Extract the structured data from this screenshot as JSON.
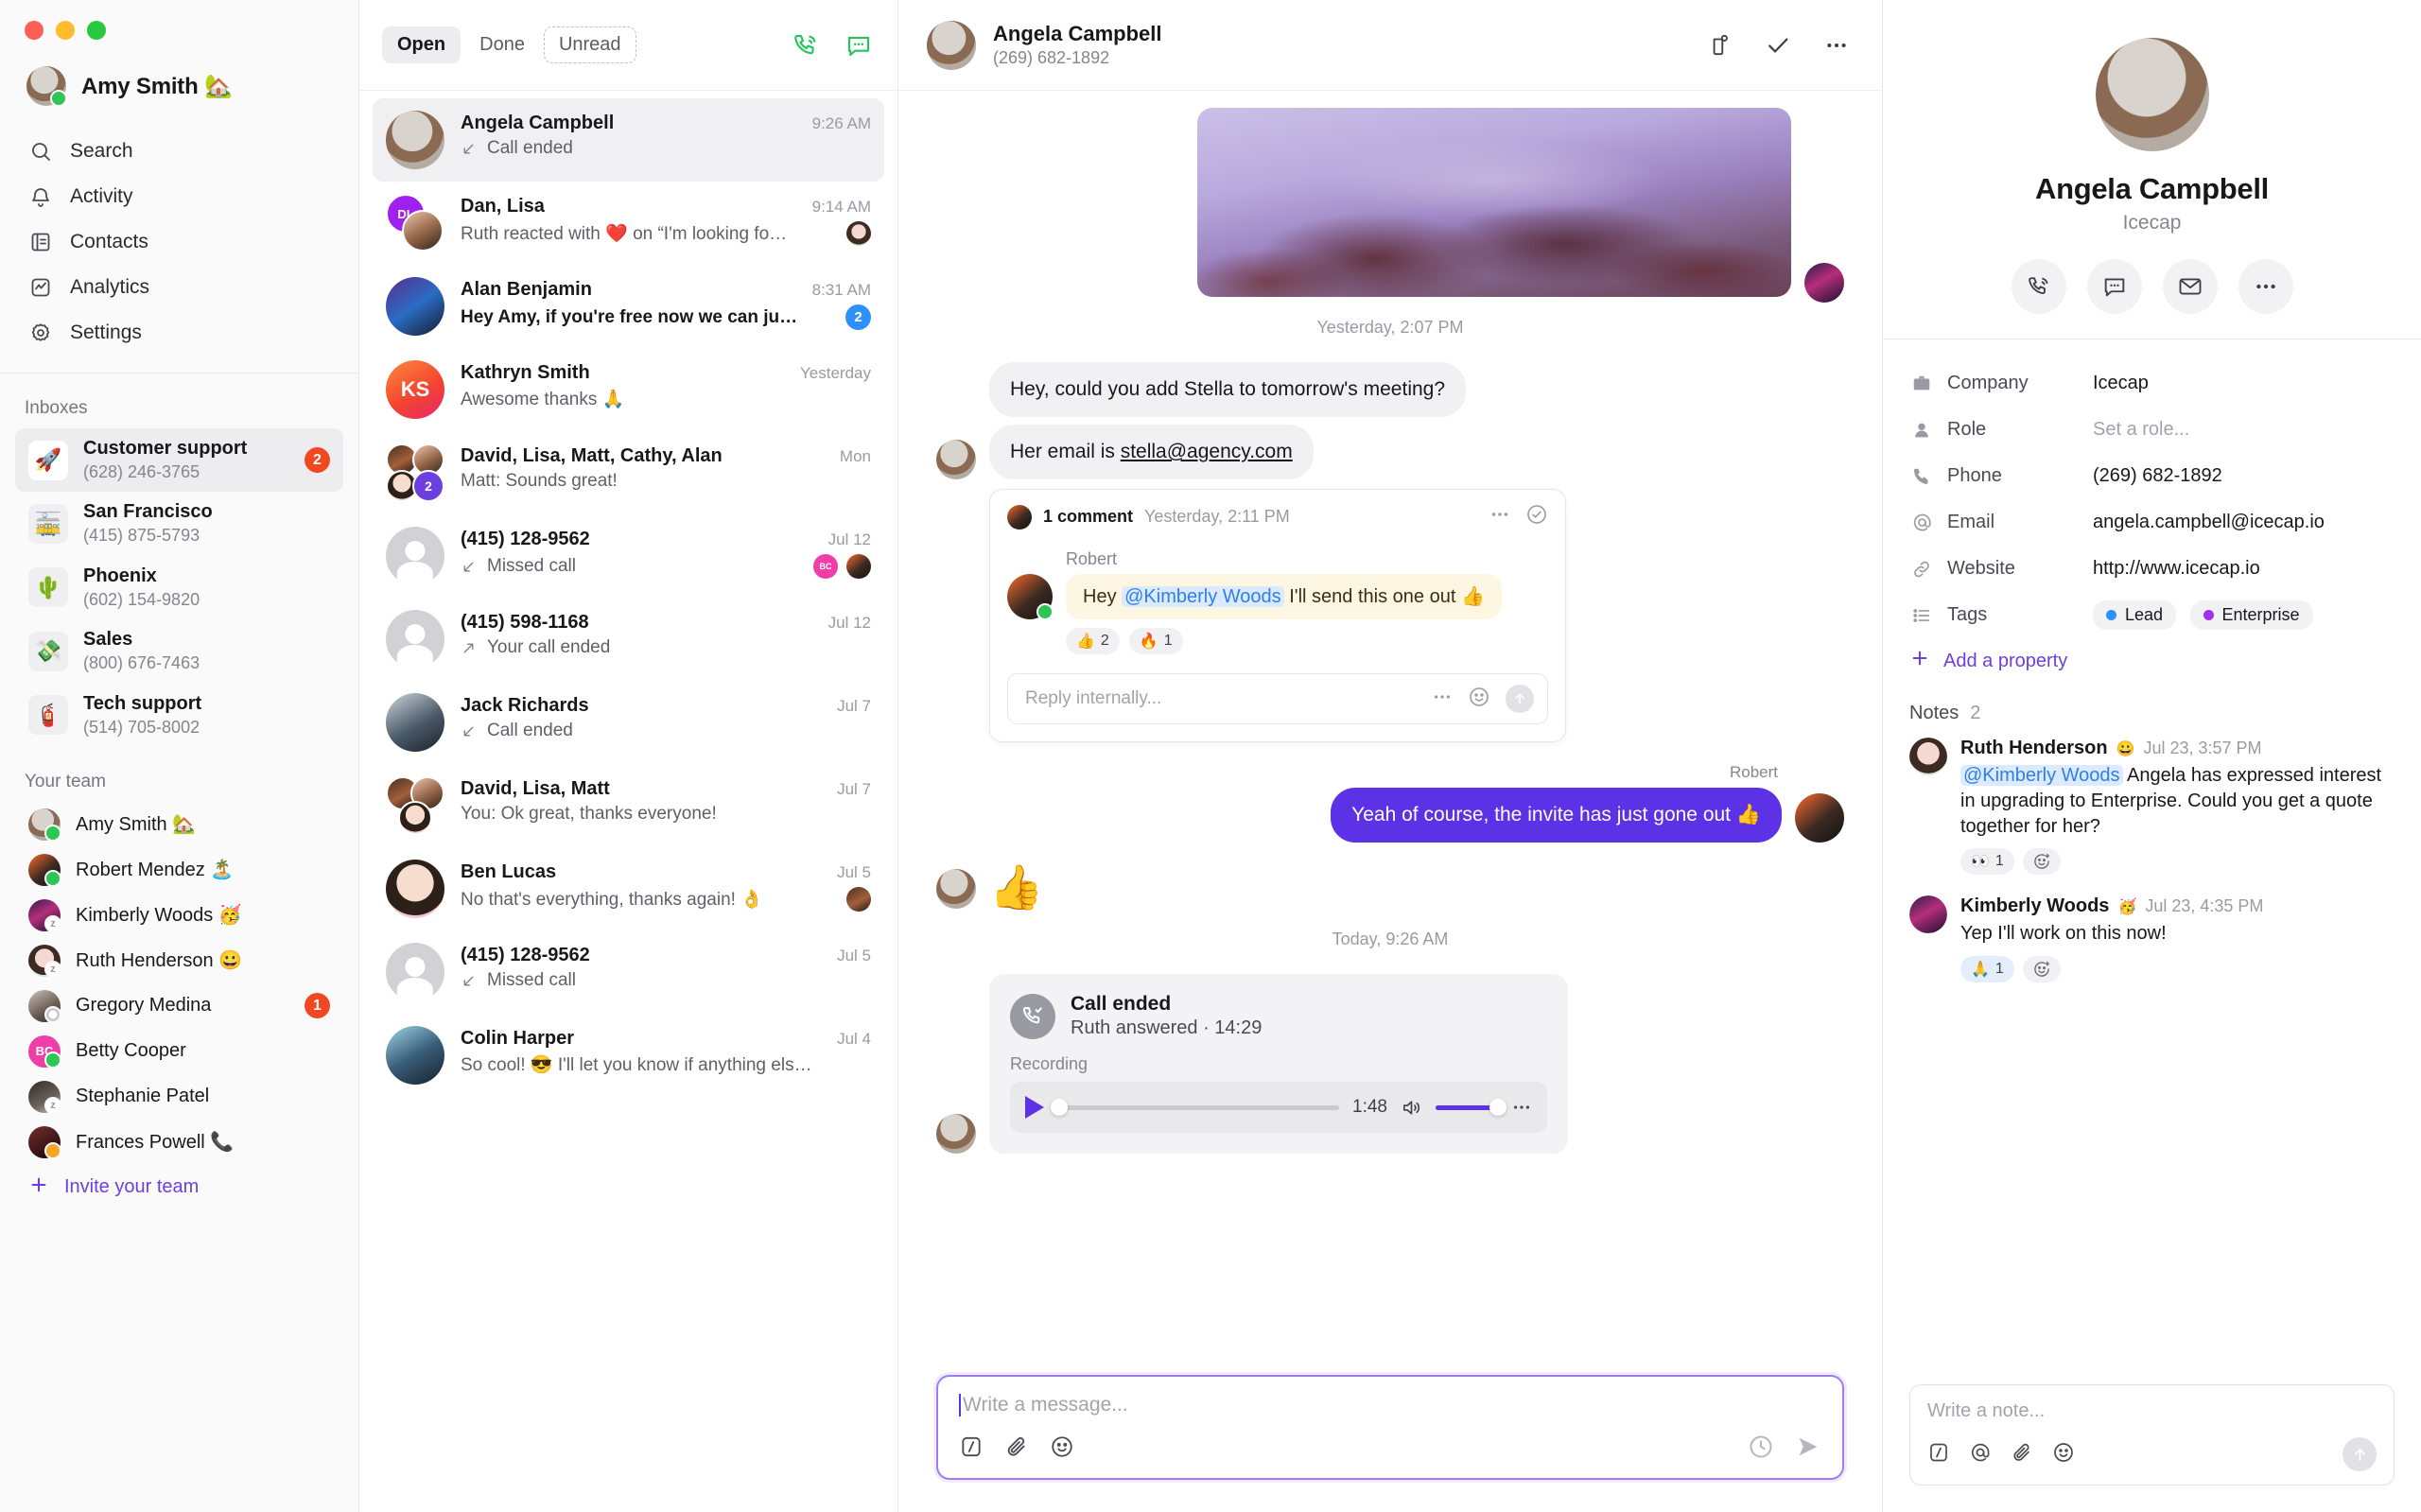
{
  "sidebar": {
    "user": {
      "name": "Amy Smith",
      "emoji": "🏡",
      "status": "online"
    },
    "nav": [
      {
        "label": "Search",
        "icon": "search-icon"
      },
      {
        "label": "Activity",
        "icon": "bell-icon"
      },
      {
        "label": "Contacts",
        "icon": "contacts-book-icon"
      },
      {
        "label": "Analytics",
        "icon": "analytics-icon"
      },
      {
        "label": "Settings",
        "icon": "gear-icon"
      }
    ],
    "inboxes_title": "Inboxes",
    "inboxes": [
      {
        "name": "Customer support",
        "phone": "(628) 246-3765",
        "emoji": "🚀",
        "badge": "2",
        "active": true
      },
      {
        "name": "San Francisco",
        "phone": "(415) 875-5793",
        "emoji": "🚋",
        "badge": "",
        "active": false
      },
      {
        "name": "Phoenix",
        "phone": "(602) 154-9820",
        "emoji": "🌵",
        "badge": "",
        "active": false
      },
      {
        "name": "Sales",
        "phone": "(800) 676-7463",
        "emoji": "💸",
        "badge": "",
        "active": false
      },
      {
        "name": "Tech support",
        "phone": "(514) 705-8002",
        "emoji": "🧯",
        "badge": "",
        "active": false
      }
    ],
    "team_title": "Your team",
    "team": [
      {
        "name": "Amy Smith",
        "emoji": "🏡",
        "status": "online",
        "badge": "",
        "av": "ph1"
      },
      {
        "name": "Robert Mendez",
        "emoji": "🏝️",
        "status": "online",
        "badge": "",
        "av": "ph2"
      },
      {
        "name": "Kimberly Woods",
        "emoji": "🥳",
        "status": "snooze",
        "badge": "",
        "av": "ph3"
      },
      {
        "name": "Ruth Henderson",
        "emoji": "😀",
        "status": "snooze",
        "badge": "",
        "av": "ph4"
      },
      {
        "name": "Gregory Medina",
        "emoji": "",
        "status": "offline",
        "badge": "1",
        "av": "ph5"
      },
      {
        "name": "Betty Cooper",
        "emoji": "",
        "status": "online",
        "badge": "",
        "av": "bc-grad",
        "initials": "BC"
      },
      {
        "name": "Stephanie Patel",
        "emoji": "",
        "status": "snooze",
        "badge": "",
        "av": "ph6"
      },
      {
        "name": "Frances Powell",
        "emoji": "📞",
        "status": "away",
        "badge": "",
        "av": "ph8"
      }
    ],
    "invite_label": "Invite your team"
  },
  "conversation_list": {
    "filters": [
      {
        "label": "Open",
        "active": true,
        "style": "active"
      },
      {
        "label": "Done",
        "active": false,
        "style": "plain"
      },
      {
        "label": "Unread",
        "active": false,
        "style": "dashed"
      }
    ],
    "header_icons": [
      "phone-call-icon",
      "new-message-icon"
    ],
    "items": [
      {
        "name": "Angela Campbell",
        "time": "9:26 AM",
        "preview": "Call ended",
        "dir": "in",
        "active": true,
        "av": "ph1",
        "badge": "",
        "bold": false
      },
      {
        "name": "Dan, Lisa",
        "time": "9:14 AM",
        "preview": "Ruth reacted with ❤️ on “I'm looking fo…",
        "dir": "",
        "active": false,
        "av": "stack-dl",
        "badge": "",
        "bold": false,
        "mini": "ph4"
      },
      {
        "name": "Alan Benjamin",
        "time": "8:31 AM",
        "preview": "Hey Amy, if you're free now we can ju…",
        "dir": "",
        "active": false,
        "av": "ph9",
        "badge": "2",
        "bold": true
      },
      {
        "name": "Kathryn Smith",
        "time": "Yesterday",
        "preview": "Awesome thanks 🙏",
        "dir": "",
        "active": false,
        "av": "ks-grad",
        "initials": "KS",
        "badge": "",
        "bold": false
      },
      {
        "name": "David, Lisa, Matt, Cathy, Alan",
        "time": "Mon",
        "preview": "Matt: Sounds great!",
        "dir": "",
        "active": false,
        "av": "stack-4",
        "badge": "2",
        "bold": false
      },
      {
        "name": "(415) 128-9562",
        "time": "Jul 12",
        "preview": "Missed call",
        "dir": "in",
        "active": false,
        "av": "ph-grey",
        "badge": "",
        "bold": false,
        "mini2": true
      },
      {
        "name": "(415) 598-1168",
        "time": "Jul 12",
        "preview": "Your call ended",
        "dir": "out",
        "active": false,
        "av": "ph-grey",
        "badge": "",
        "bold": false
      },
      {
        "name": "Jack Richards",
        "time": "Jul 7",
        "preview": "Call ended",
        "dir": "in",
        "active": false,
        "av": "ph11",
        "badge": "",
        "bold": false
      },
      {
        "name": "David, Lisa, Matt",
        "time": "Jul 7",
        "preview": "You: Ok great, thanks everyone!",
        "dir": "",
        "active": false,
        "av": "stack-3",
        "badge": "",
        "bold": false
      },
      {
        "name": "Ben Lucas",
        "time": "Jul 5",
        "preview": "No that's everything, thanks again! 👌",
        "dir": "",
        "active": false,
        "av": "ph12",
        "badge": "",
        "bold": false,
        "mini": "ph7"
      },
      {
        "name": "(415) 128-9562",
        "time": "Jul 5",
        "preview": "Missed call",
        "dir": "in",
        "active": false,
        "av": "ph-grey",
        "badge": "",
        "bold": false
      },
      {
        "name": "Colin Harper",
        "time": "Jul 4",
        "preview": "So cool! 😎 I'll let you know if anything els…",
        "dir": "",
        "active": false,
        "av": "ph13",
        "badge": "",
        "bold": false
      }
    ]
  },
  "thread": {
    "title": "Angela Campbell",
    "subtitle": "(269) 682-1892",
    "actions": [
      "snooze-icon",
      "mark-done-icon",
      "more-options-icon"
    ],
    "day_sep_1": "Yesterday, 2:07 PM",
    "messages": [
      {
        "type": "image",
        "side": "in"
      },
      {
        "type": "text",
        "side": "in",
        "text": "Hey, could you add Stella to tomorrow's meeting?"
      },
      {
        "type": "text",
        "side": "in",
        "text": "Her email is ",
        "link": "stella@agency.com"
      }
    ],
    "comment": {
      "count_label": "1 comment",
      "time": "Yesterday, 2:11 PM",
      "author": "Robert",
      "text_before": "Hey ",
      "mention": "@Kimberly Woods",
      "text_after": " I'll send this one out 👍",
      "reactions": [
        {
          "emoji": "👍",
          "count": "2"
        },
        {
          "emoji": "🔥",
          "count": "1"
        }
      ],
      "reply_placeholder": "Reply internally..."
    },
    "outgoing": {
      "sender": "Robert",
      "text": "Yeah of course, the invite has just gone out 👍"
    },
    "reaction_msg": "👍",
    "day_sep_2": "Today, 9:26 AM",
    "call_card": {
      "title": "Call ended",
      "subtitle": "Ruth answered · 14:29",
      "recording_label": "Recording",
      "duration": "1:48"
    },
    "composer": {
      "placeholder": "Write a message...",
      "icons": [
        "snippet-icon",
        "attachment-icon",
        "emoji-icon",
        "schedule-send-icon",
        "send-icon"
      ]
    }
  },
  "right_panel": {
    "name": "Angela Campbell",
    "company": "Icecap",
    "actions": [
      "call-icon",
      "message-icon",
      "email-icon",
      "more-options-icon"
    ],
    "properties": [
      {
        "icon": "briefcase-icon",
        "label": "Company",
        "value": "Icecap",
        "muted": false
      },
      {
        "icon": "person-icon",
        "label": "Role",
        "value": "Set a role...",
        "muted": true
      },
      {
        "icon": "phone-icon",
        "label": "Phone",
        "value": "(269) 682-1892",
        "muted": false
      },
      {
        "icon": "at-icon",
        "label": "Email",
        "value": "angela.campbell@icecap.io",
        "muted": false
      },
      {
        "icon": "link-icon",
        "label": "Website",
        "value": "http://www.icecap.io",
        "muted": false
      }
    ],
    "tags_label": "Tags",
    "tags": [
      {
        "label": "Lead",
        "color": "#2e90fa"
      },
      {
        "label": "Enterprise",
        "color": "#a033e8"
      }
    ],
    "add_property_label": "Add a property",
    "notes_title": "Notes",
    "notes_count": "2",
    "notes": [
      {
        "author": "Ruth Henderson",
        "emoji": "😀",
        "time": "Jul 23, 3:57 PM",
        "mention": "@Kimberly Woods",
        "text": " Angela has expressed interest in upgrading to Enterprise. Could you get a quote together for her?",
        "reactions": [
          {
            "emoji": "👀",
            "count": "1"
          }
        ],
        "av": "ph4"
      },
      {
        "author": "Kimberly Woods",
        "emoji": "🥳",
        "time": "Jul 23, 4:35 PM",
        "mention": "",
        "text": "Yep I'll work on this now!",
        "reactions": [
          {
            "emoji": "🙏",
            "count": "1"
          }
        ],
        "av": "ph3"
      }
    ],
    "note_composer": {
      "placeholder": "Write a note...",
      "icons": [
        "snippet-icon",
        "mention-icon",
        "attachment-icon",
        "emoji-icon",
        "send-icon"
      ]
    }
  },
  "colors": {
    "accent": "#5d31e6",
    "badge_red": "#f24822",
    "badge_blue": "#2e90fa",
    "green": "#22c55e"
  }
}
